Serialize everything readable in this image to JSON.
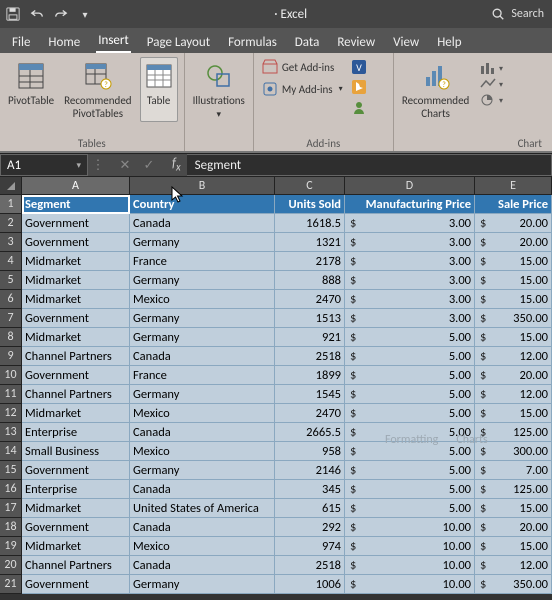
{
  "titlebar": {
    "app_label": "·  Excel",
    "search_placeholder": "Search"
  },
  "tabs": [
    "File",
    "Home",
    "Insert",
    "Page Layout",
    "Formulas",
    "Data",
    "Review",
    "View",
    "Help"
  ],
  "active_tab_index": 2,
  "ribbon": {
    "tables": {
      "pivot": "PivotTable",
      "recpivot": "Recommended\nPivotTables",
      "table": "Table",
      "group": "Tables"
    },
    "illus": {
      "btn": "Illustrations",
      "group": ""
    },
    "addins": {
      "get": "Get Add-ins",
      "my": "My Add-ins",
      "group": "Add-ins"
    },
    "charts": {
      "rec": "Recommended\nCharts",
      "group": "Chart"
    }
  },
  "fx": {
    "name_box": "A1",
    "formula_value": "Segment"
  },
  "col_headers": [
    "A",
    "B",
    "C",
    "D",
    "E"
  ],
  "table_headers": {
    "seg": "Segment",
    "con": "Country",
    "us": "Units Sold",
    "mp": "Manufacturing Price",
    "sp": "Sale Price"
  },
  "rows": [
    {
      "n": 2,
      "seg": "Government",
      "con": "Canada",
      "us": "1618.5",
      "mp": "3.00",
      "sp": "20.00"
    },
    {
      "n": 3,
      "seg": "Government",
      "con": "Germany",
      "us": "1321",
      "mp": "3.00",
      "sp": "20.00"
    },
    {
      "n": 4,
      "seg": "Midmarket",
      "con": "France",
      "us": "2178",
      "mp": "3.00",
      "sp": "15.00"
    },
    {
      "n": 5,
      "seg": "Midmarket",
      "con": "Germany",
      "us": "888",
      "mp": "3.00",
      "sp": "15.00"
    },
    {
      "n": 6,
      "seg": "Midmarket",
      "con": "Mexico",
      "us": "2470",
      "mp": "3.00",
      "sp": "15.00"
    },
    {
      "n": 7,
      "seg": "Government",
      "con": "Germany",
      "us": "1513",
      "mp": "3.00",
      "sp": "350.00"
    },
    {
      "n": 8,
      "seg": "Midmarket",
      "con": "Germany",
      "us": "921",
      "mp": "5.00",
      "sp": "15.00"
    },
    {
      "n": 9,
      "seg": "Channel Partners",
      "con": "Canada",
      "us": "2518",
      "mp": "5.00",
      "sp": "12.00"
    },
    {
      "n": 10,
      "seg": "Government",
      "con": "France",
      "us": "1899",
      "mp": "5.00",
      "sp": "20.00"
    },
    {
      "n": 11,
      "seg": "Channel Partners",
      "con": "Germany",
      "us": "1545",
      "mp": "5.00",
      "sp": "12.00"
    },
    {
      "n": 12,
      "seg": "Midmarket",
      "con": "Mexico",
      "us": "2470",
      "mp": "5.00",
      "sp": "15.00"
    },
    {
      "n": 13,
      "seg": "Enterprise",
      "con": "Canada",
      "us": "2665.5",
      "mp": "5.00",
      "sp": "125.00"
    },
    {
      "n": 14,
      "seg": "Small Business",
      "con": "Mexico",
      "us": "958",
      "mp": "5.00",
      "sp": "300.00"
    },
    {
      "n": 15,
      "seg": "Government",
      "con": "Germany",
      "us": "2146",
      "mp": "5.00",
      "sp": "7.00"
    },
    {
      "n": 16,
      "seg": "Enterprise",
      "con": "Canada",
      "us": "345",
      "mp": "5.00",
      "sp": "125.00"
    },
    {
      "n": 17,
      "seg": "Midmarket",
      "con": "United States of America",
      "us": "615",
      "mp": "5.00",
      "sp": "15.00"
    },
    {
      "n": 18,
      "seg": "Government",
      "con": "Canada",
      "us": "292",
      "mp": "10.00",
      "sp": "20.00"
    },
    {
      "n": 19,
      "seg": "Midmarket",
      "con": "Mexico",
      "us": "974",
      "mp": "10.00",
      "sp": "15.00"
    },
    {
      "n": 20,
      "seg": "Channel Partners",
      "con": "Canada",
      "us": "2518",
      "mp": "10.00",
      "sp": "12.00"
    },
    {
      "n": 21,
      "seg": "Government",
      "con": "Germany",
      "us": "1006",
      "mp": "10.00",
      "sp": "350.00"
    }
  ],
  "ghost": {
    "a": "Formatting",
    "b": "Charts"
  }
}
